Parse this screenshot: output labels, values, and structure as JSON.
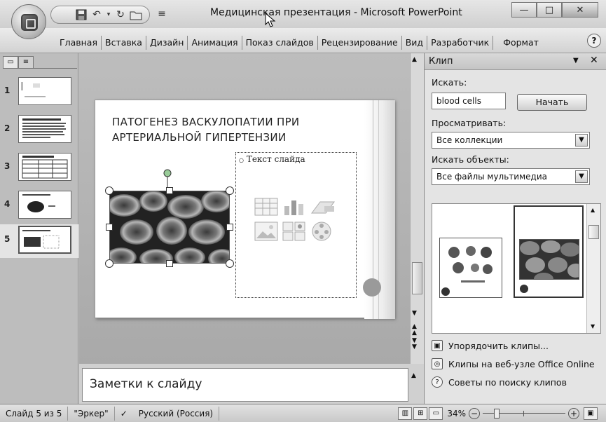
{
  "window": {
    "title": "Медицинская презентация - Microsoft PowerPoint"
  },
  "ribbon": {
    "tabs": [
      "Главная",
      "Вставка",
      "Дизайн",
      "Анимация",
      "Показ слайдов",
      "Рецензирование",
      "Вид",
      "Разработчик",
      "Формат"
    ]
  },
  "slides_panel": {
    "slides": [
      {
        "num": "1"
      },
      {
        "num": "2"
      },
      {
        "num": "3"
      },
      {
        "num": "4"
      },
      {
        "num": "5"
      }
    ],
    "selected": 5
  },
  "slide": {
    "title_line1": "Патогенез васкулопатии при",
    "title_line2": "артериальной гипертензии",
    "placeholder_text": "Текст слайда"
  },
  "notes": {
    "placeholder": "Заметки к слайду"
  },
  "clip_pane": {
    "title": "Клип",
    "search_label": "Искать:",
    "search_value": "blood cells",
    "search_button": "Начать",
    "browse_label": "Просматривать:",
    "browse_value": "Все коллекции",
    "types_label": "Искать объекты:",
    "types_value": "Все файлы мультимедиа",
    "links": [
      "Упорядочить клипы...",
      "Клипы на веб-узле Office Online",
      "Советы по поиску клипов"
    ]
  },
  "status_bar": {
    "slide_info": "Слайд 5 из 5",
    "theme": "\"Эркер\"",
    "language": "Русский (Россия)",
    "zoom": "34%"
  },
  "colors": {
    "chrome": "#c8c8c8",
    "slide_bg": "#ffffff",
    "circle_accent": "#9a9a9a"
  }
}
